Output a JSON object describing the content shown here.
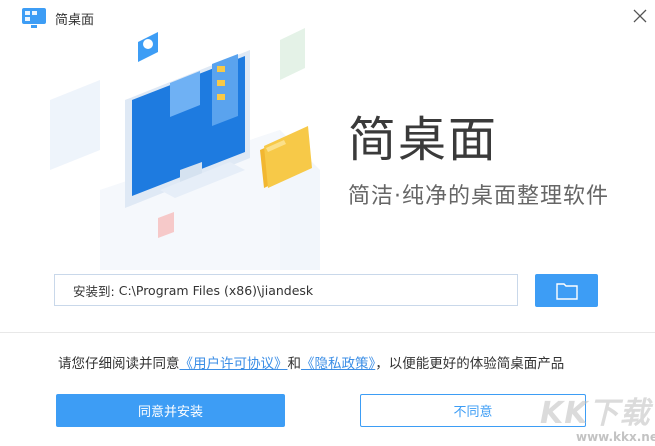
{
  "window": {
    "title": "简桌面",
    "close_icon": "close-icon"
  },
  "hero": {
    "brand_name": "简桌面",
    "slogan": "简洁·纯净的桌面整理软件"
  },
  "install": {
    "label": "安装到:",
    "path": "C:\\Program Files (x86)\\jiandesk",
    "browse_icon": "folder-icon"
  },
  "agreement": {
    "prefix": "请您仔细阅读并同意",
    "user_license": "《用户许可协议》",
    "and": "和",
    "privacy_policy": "《隐私政策》",
    "suffix": "，以便能更好的体验简桌面产品"
  },
  "buttons": {
    "agree_install": "同意并安装",
    "disagree": "不同意"
  },
  "watermark": {
    "text": "KK下载",
    "url": "www.kkx.net"
  },
  "colors": {
    "accent": "#3d9df5",
    "link": "#3b8ee6",
    "screen_blue": "#1e7be0",
    "folder_yellow": "#f7c948"
  }
}
